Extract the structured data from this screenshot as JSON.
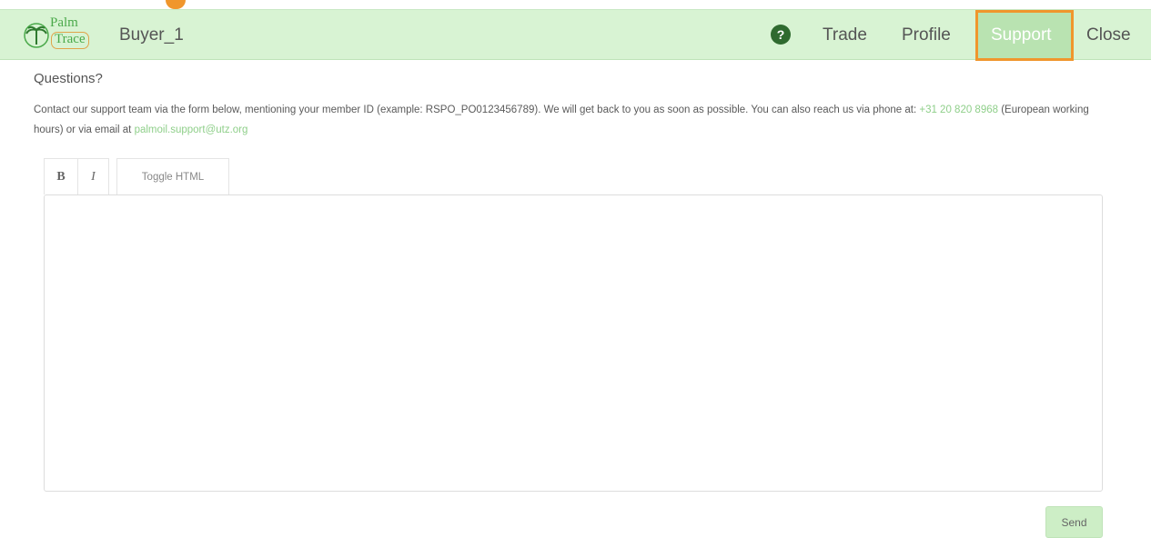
{
  "header": {
    "logo_top": "Palm",
    "logo_bottom": "Trace",
    "user": "Buyer_1",
    "help_icon": "question-circle-icon",
    "nav": {
      "trade": "Trade",
      "profile": "Profile",
      "support": "Support",
      "close": "Close"
    }
  },
  "content": {
    "title": "Questions?",
    "intro_before_phone": "Contact our support team via the form below, mentioning your member ID (example: RSPO_PO0123456789). We will get back to you as soon as possible. You can also reach us via phone at: ",
    "phone": "+31 20 820 8968",
    "intro_between": " (European working hours) or via email at ",
    "email": "palmoil.support@utz.org"
  },
  "editor": {
    "bold_label": "B",
    "italic_label": "I",
    "toggle_html_label": "Toggle HTML",
    "value": ""
  },
  "send_label": "Send",
  "colors": {
    "header_bg": "#d8f3d3",
    "accent_green": "#8fcf8a",
    "highlight_orange": "#f0962c"
  }
}
